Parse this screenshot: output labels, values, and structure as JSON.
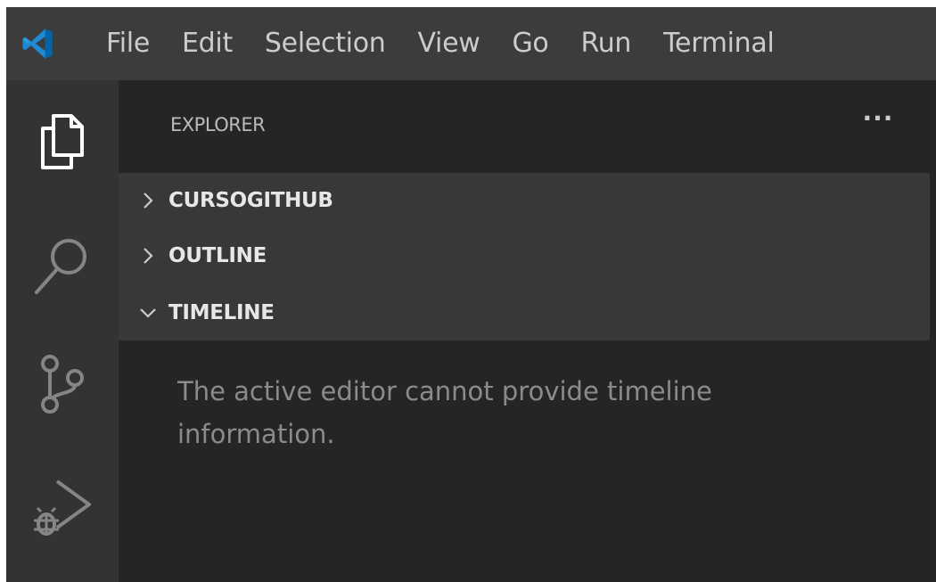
{
  "menubar": {
    "items": [
      {
        "label": "File"
      },
      {
        "label": "Edit"
      },
      {
        "label": "Selection"
      },
      {
        "label": "View"
      },
      {
        "label": "Go"
      },
      {
        "label": "Run"
      },
      {
        "label": "Terminal"
      }
    ]
  },
  "activitybar": {
    "items": [
      {
        "icon": "files-icon",
        "name": "explorer",
        "active": true
      },
      {
        "icon": "search-icon",
        "name": "search"
      },
      {
        "icon": "source-control-icon",
        "name": "source-control"
      },
      {
        "icon": "run-debug-icon",
        "name": "run-and-debug"
      }
    ]
  },
  "sidebar": {
    "title": "EXPLORER",
    "more_actions": "···",
    "sections": [
      {
        "label": "CURSOGITHUB",
        "expanded": false
      },
      {
        "label": "OUTLINE",
        "expanded": false
      },
      {
        "label": "TIMELINE",
        "expanded": true
      }
    ],
    "timeline_message": "The active editor cannot provide timeline information."
  },
  "colors": {
    "accent": "#007acc",
    "menubar_bg": "#3c3c3c",
    "activitybar_bg": "#333333",
    "sidebar_bg": "#252526",
    "section_bg": "#383838",
    "text_muted": "#8b8b8b"
  }
}
